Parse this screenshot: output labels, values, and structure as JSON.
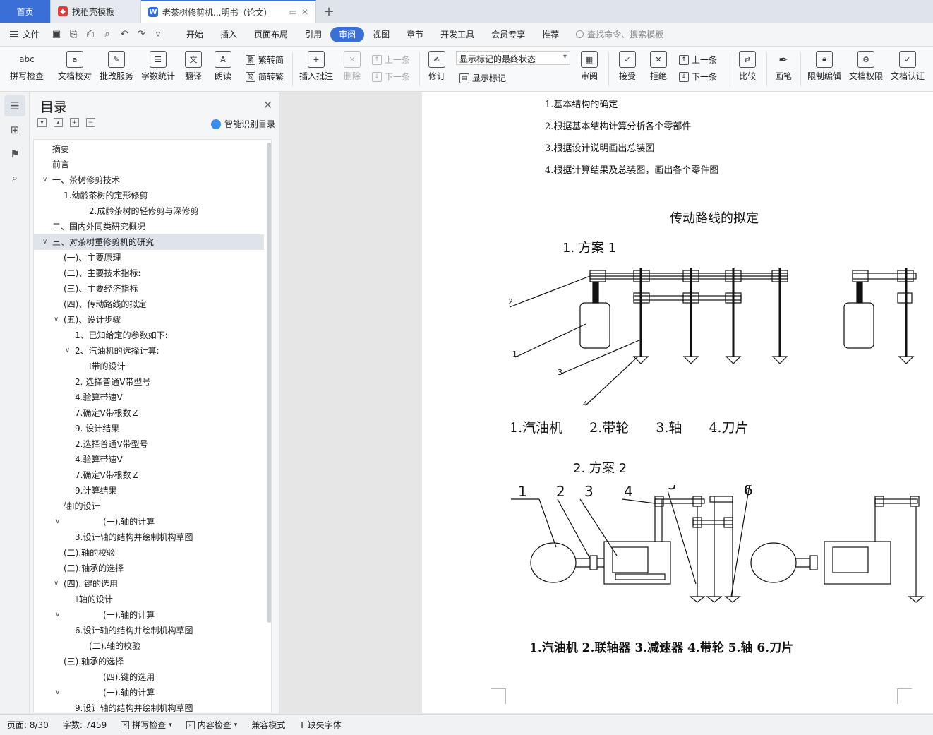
{
  "tabs": [
    {
      "label": "首页"
    },
    {
      "label": "找稻壳模板"
    },
    {
      "label": "老茶树修剪机...明书（论文）"
    }
  ],
  "menu": {
    "file": "文件",
    "items": [
      "开始",
      "插入",
      "页面布局",
      "引用",
      "审阅",
      "视图",
      "章节",
      "开发工具",
      "会员专享",
      "推荐"
    ],
    "active": "审阅",
    "search_placeholder": "查找命令、搜索模板"
  },
  "ribbon": {
    "spell": "拼写检查",
    "doc_check": "文档校对",
    "revise_service": "批改服务",
    "word_count": "字数统计",
    "translate": "翻译",
    "read_aloud": "朗读",
    "trad": "繁转简",
    "simp": "简转繁",
    "insert_comment": "插入批注",
    "delete": "删除",
    "prev": "上一条",
    "next": "下一条",
    "revise": "修订",
    "markup_state": "显示标记的最终状态",
    "show_markup": "显示标记",
    "review": "审阅",
    "accept": "接受",
    "reject": "拒绝",
    "prev2": "上一条",
    "next2": "下一条",
    "compare": "比较",
    "pen": "画笔",
    "restrict": "限制编辑",
    "doc_perm": "文档权限",
    "doc_cert": "文档认证"
  },
  "toc": {
    "title": "目录",
    "smart": "智能识别目录",
    "items": [
      {
        "label": "摘要",
        "indent": 0,
        "caret": ""
      },
      {
        "label": "前言",
        "indent": 0,
        "caret": ""
      },
      {
        "label": "一、茶树修剪技术",
        "indent": 0,
        "caret": "v"
      },
      {
        "label": "1.幼龄茶树的定形修剪",
        "indent": 1,
        "caret": ""
      },
      {
        "label": "2.成龄茶树的轻修剪与深修剪",
        "indent": 3,
        "caret": ""
      },
      {
        "label": "二、国内外同类研究概况",
        "indent": 0,
        "caret": ""
      },
      {
        "label": "三、对茶树重修剪机的研究",
        "indent": 0,
        "caret": "v"
      },
      {
        "label": "(一)、主要原理",
        "indent": 1,
        "caret": ""
      },
      {
        "label": "(二)、主要技术指标:",
        "indent": 1,
        "caret": ""
      },
      {
        "label": "(三)、主要经济指标",
        "indent": 1,
        "caret": ""
      },
      {
        "label": "(四)、传动路线的拟定",
        "indent": 1,
        "caret": ""
      },
      {
        "label": "(五)、设计步骤",
        "indent": 1,
        "caret": "v"
      },
      {
        "label": "1、已知给定的参数如下:",
        "indent": 2,
        "caret": ""
      },
      {
        "label": "2、汽油机的选择计算:",
        "indent": 2,
        "caret": "v"
      },
      {
        "label": "Ⅰ带的设计",
        "indent": 3,
        "caret": ""
      },
      {
        "label": "2. 选择普通Ⅴ带型号",
        "indent": 2,
        "caret": ""
      },
      {
        "label": "4.验算带速Ⅴ",
        "indent": 2,
        "caret": ""
      },
      {
        "label": "7.确定Ⅴ带根数Ｚ",
        "indent": 2,
        "caret": ""
      },
      {
        "label": "9. 设计结果",
        "indent": 2,
        "caret": ""
      },
      {
        "label": "2.选择普通Ⅴ带型号",
        "indent": 2,
        "caret": ""
      },
      {
        "label": "4.验算带速Ⅴ",
        "indent": 2,
        "caret": ""
      },
      {
        "label": "7.确定Ⅴ带根数Ｚ",
        "indent": 2,
        "caret": ""
      },
      {
        "label": "9.计算结果",
        "indent": 2,
        "caret": ""
      },
      {
        "label": "轴Ⅰ的设计",
        "indent": 1,
        "caret": ""
      },
      {
        "label": "(一).轴的计算",
        "indent": 4,
        "caret": "v"
      },
      {
        "label": "3.设计轴的结构并绘制机构草图",
        "indent": 2,
        "caret": ""
      },
      {
        "label": "(二).轴的校验",
        "indent": 1,
        "caret": ""
      },
      {
        "label": "(三).轴承的选择",
        "indent": 1,
        "caret": ""
      },
      {
        "label": "(四). 键的选用",
        "indent": 1,
        "caret": "v"
      },
      {
        "label": "Ⅱ轴的设计",
        "indent": 2,
        "caret": ""
      },
      {
        "label": "(一).轴的计算",
        "indent": 4,
        "caret": "v"
      },
      {
        "label": "6.设计轴的结构并绘制机构草图",
        "indent": 2,
        "caret": ""
      },
      {
        "label": "(二).轴的校验",
        "indent": 3,
        "caret": ""
      },
      {
        "label": "(三).轴承的选择",
        "indent": 1,
        "caret": ""
      },
      {
        "label": "(四).键的选用",
        "indent": 4,
        "caret": ""
      },
      {
        "label": "(一).轴的计算",
        "indent": 4,
        "caret": "v"
      },
      {
        "label": "9.设计轴的结构并绘制机构草图",
        "indent": 2,
        "caret": ""
      }
    ]
  },
  "document": {
    "steps": [
      "1.基本结构的确定",
      "2.根据基本结构计算分析各个零部件",
      "3.根据设计说明画出总装图",
      "4.根据计算结果及总装图，画出各个零件图"
    ],
    "section_title": "传动路线的拟定",
    "scheme1_title": "1. 方案 1",
    "scheme1_labels": [
      "1",
      "2",
      "3",
      "4"
    ],
    "scheme1_caption": "1.汽油机　　2.带轮　　3.轴　　4.刀片",
    "scheme2_title": "2. 方案 2",
    "scheme2_labels": [
      "1",
      "2",
      "3",
      "4",
      "5",
      "6"
    ],
    "scheme2_caption": "1.汽油机 2.联轴器 3.减速器 4.带轮 5.轴 6.刀片"
  },
  "status": {
    "page": "页面: 8/30",
    "words": "字数: 7459",
    "spell": "拼写检查",
    "content": "内容检查",
    "compat": "兼容模式",
    "missing_font": "缺失字体"
  }
}
